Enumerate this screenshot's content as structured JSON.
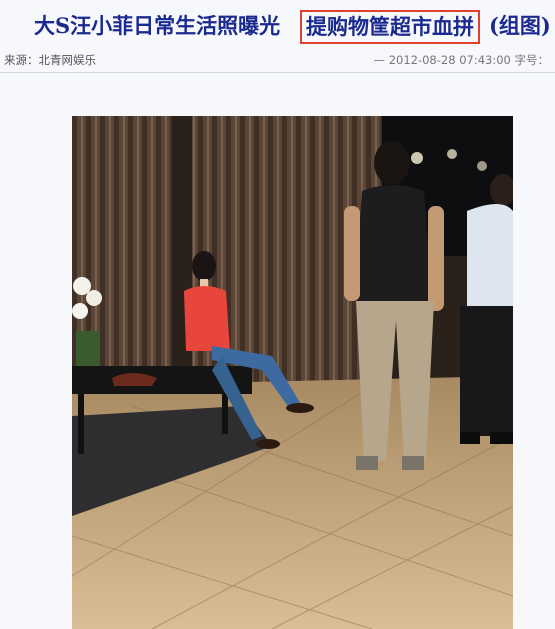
{
  "article": {
    "title_part1": "大S汪小菲日常生活照曝光",
    "title_highlight": "提购物筐超市血拼",
    "title_part3": "(组图)",
    "source": "来源：北青网娱乐",
    "datetime": "— 2012-08-28 07:43:00",
    "font_size_label": "字号："
  },
  "colors": {
    "title": "#1b2a8f",
    "highlight_border": "#e0402f",
    "background": "#f7f8fc"
  }
}
